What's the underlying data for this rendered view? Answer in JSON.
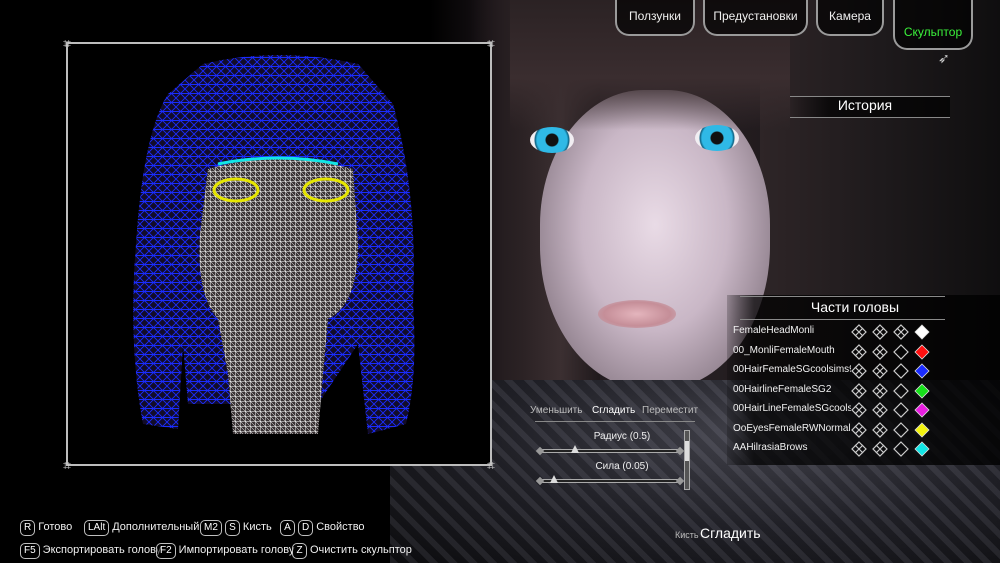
{
  "tabs": [
    {
      "label": "Ползунки",
      "active": false
    },
    {
      "label": "Предустановки",
      "active": false
    },
    {
      "label": "Камера",
      "active": false
    },
    {
      "label": "Скульптор",
      "active": true
    }
  ],
  "history": {
    "title": "История"
  },
  "head_parts": {
    "title": "Части головы",
    "items": [
      {
        "name": "FemaleHeadMonli",
        "color": "#ffffff"
      },
      {
        "name": "00_MonliFemaleMouth",
        "color": "#ff1010"
      },
      {
        "name": "00HairFemaleSGcoolsims98",
        "color": "#1a2cff"
      },
      {
        "name": "00HairlineFemaleSG2",
        "color": "#16e01a"
      },
      {
        "name": "00HairLineFemaleSGcoolsims98",
        "color": "#e81ee0"
      },
      {
        "name": "OoEyesFemaleRWNormalBlue",
        "color": "#f2f20e"
      },
      {
        "name": "AAHilrasiaBrows",
        "color": "#12e6e6"
      }
    ]
  },
  "brush_tools": {
    "options": [
      "Уменьшить",
      "Сгладить",
      "Переместит"
    ],
    "selected": "Сгладить",
    "radius_label": "Радиус (0.5)",
    "radius_value": 0.5,
    "strength_label": "Сила (0.05)",
    "strength_value": 0.05
  },
  "hints": [
    {
      "keys": [
        "R"
      ],
      "label": "Готово"
    },
    {
      "keys": [
        "LAlt"
      ],
      "label": "Дополнительный"
    },
    {
      "keys": [
        "M2",
        "S"
      ],
      "label": "Кисть"
    },
    {
      "keys": [
        "A",
        "D"
      ],
      "label": "Свойство"
    },
    {
      "keys": [
        "F5"
      ],
      "label": "Экспортировать голову"
    },
    {
      "keys": [
        "F2"
      ],
      "label": "Импортировать голову"
    },
    {
      "keys": [
        "Z"
      ],
      "label": "Очистить скульптор"
    }
  ],
  "brush_status": {
    "label": "Кисть",
    "value": "Сгладить"
  },
  "colors": {
    "accent_active": "#3bf23b",
    "wire_hair": "#1a2cff",
    "wire_face": "#ffffff",
    "wire_eyes": "#e6e600"
  }
}
